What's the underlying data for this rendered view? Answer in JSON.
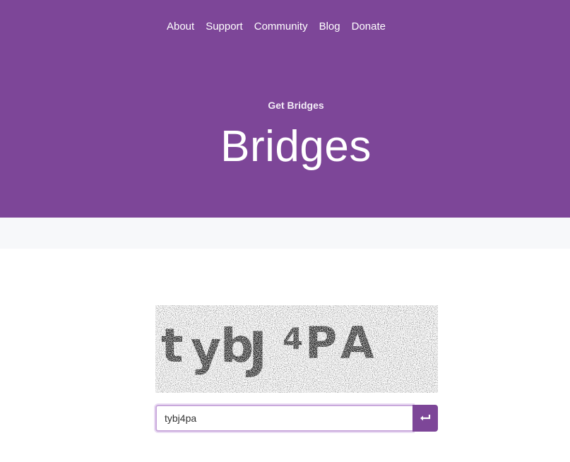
{
  "nav": {
    "items": [
      {
        "label": "About"
      },
      {
        "label": "Support"
      },
      {
        "label": "Community"
      },
      {
        "label": "Blog"
      },
      {
        "label": "Donate"
      }
    ]
  },
  "hero": {
    "eyebrow": "Get Bridges",
    "title": "Bridges"
  },
  "captcha": {
    "text": "tybJ4PA"
  },
  "form": {
    "value": "tybj4pa",
    "submit_icon": "enter-icon"
  },
  "colors": {
    "brand": "#7d4698",
    "band": "#f7f8fa",
    "input_border": "#c9a9dc"
  }
}
